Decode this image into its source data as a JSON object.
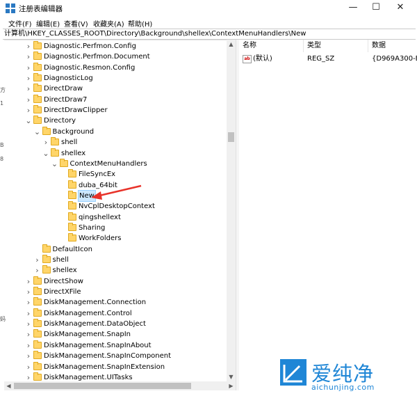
{
  "window": {
    "title": "注册表编辑器",
    "controls": {
      "minimize": "—",
      "maximize": "☐",
      "close": "✕"
    }
  },
  "menu": [
    "文件(F)",
    "编辑(E)",
    "查看(V)",
    "收藏夹(A)",
    "帮助(H)"
  ],
  "address": "计算机\\HKEY_CLASSES_ROOT\\Directory\\Background\\shellex\\ContextMenuHandlers\\New",
  "tree": [
    {
      "label": "Diagnostic.Perfmon.Config",
      "arrow": ">"
    },
    {
      "label": "Diagnostic.Perfmon.Document",
      "arrow": ">"
    },
    {
      "label": "Diagnostic.Resmon.Config",
      "arrow": ">"
    },
    {
      "label": "DiagnosticLog",
      "arrow": ">"
    },
    {
      "label": "DirectDraw",
      "arrow": ">"
    },
    {
      "label": "DirectDraw7",
      "arrow": ">"
    },
    {
      "label": "DirectDrawClipper",
      "arrow": ">"
    },
    {
      "label": "Directory",
      "arrow": "v"
    },
    {
      "label": "Background",
      "arrow": "v"
    },
    {
      "label": "shell",
      "arrow": ">"
    },
    {
      "label": "shellex",
      "arrow": "v"
    },
    {
      "label": "ContextMenuHandlers",
      "arrow": "v"
    },
    {
      "label": "FileSyncEx",
      "arrow": ""
    },
    {
      "label": "duba_64bit",
      "arrow": ""
    },
    {
      "label": "New",
      "arrow": ""
    },
    {
      "label": "NvCplDesktopContext",
      "arrow": ""
    },
    {
      "label": "qingshellext",
      "arrow": ""
    },
    {
      "label": "Sharing",
      "arrow": ""
    },
    {
      "label": "WorkFolders",
      "arrow": ""
    },
    {
      "label": "DefaultIcon",
      "arrow": ""
    },
    {
      "label": "shell",
      "arrow": ">"
    },
    {
      "label": "shellex",
      "arrow": ">"
    },
    {
      "label": "DirectShow",
      "arrow": ">"
    },
    {
      "label": "DirectXFile",
      "arrow": ">"
    },
    {
      "label": "DiskManagement.Connection",
      "arrow": ">"
    },
    {
      "label": "DiskManagement.Control",
      "arrow": ">"
    },
    {
      "label": "DiskManagement.DataObject",
      "arrow": ">"
    },
    {
      "label": "DiskManagement.SnapIn",
      "arrow": ">"
    },
    {
      "label": "DiskManagement.SnapInAbout",
      "arrow": ">"
    },
    {
      "label": "DiskManagement.SnapInComponent",
      "arrow": ">"
    },
    {
      "label": "DiskManagement.SnapInExtension",
      "arrow": ">"
    },
    {
      "label": "DiskManagement.UITasks",
      "arrow": ">"
    }
  ],
  "list": {
    "headers": {
      "name": "名称",
      "type": "类型",
      "data": "数据"
    },
    "rows": [
      {
        "icon": "ab",
        "name": "(默认)",
        "type": "REG_SZ",
        "data": "{D969A300-E"
      }
    ]
  },
  "watermark": {
    "cn": "爱纯净",
    "en": "aichunjing.com"
  },
  "left_edge_chars": [
    "方",
    "1",
    "B",
    "8",
    "蚂"
  ]
}
